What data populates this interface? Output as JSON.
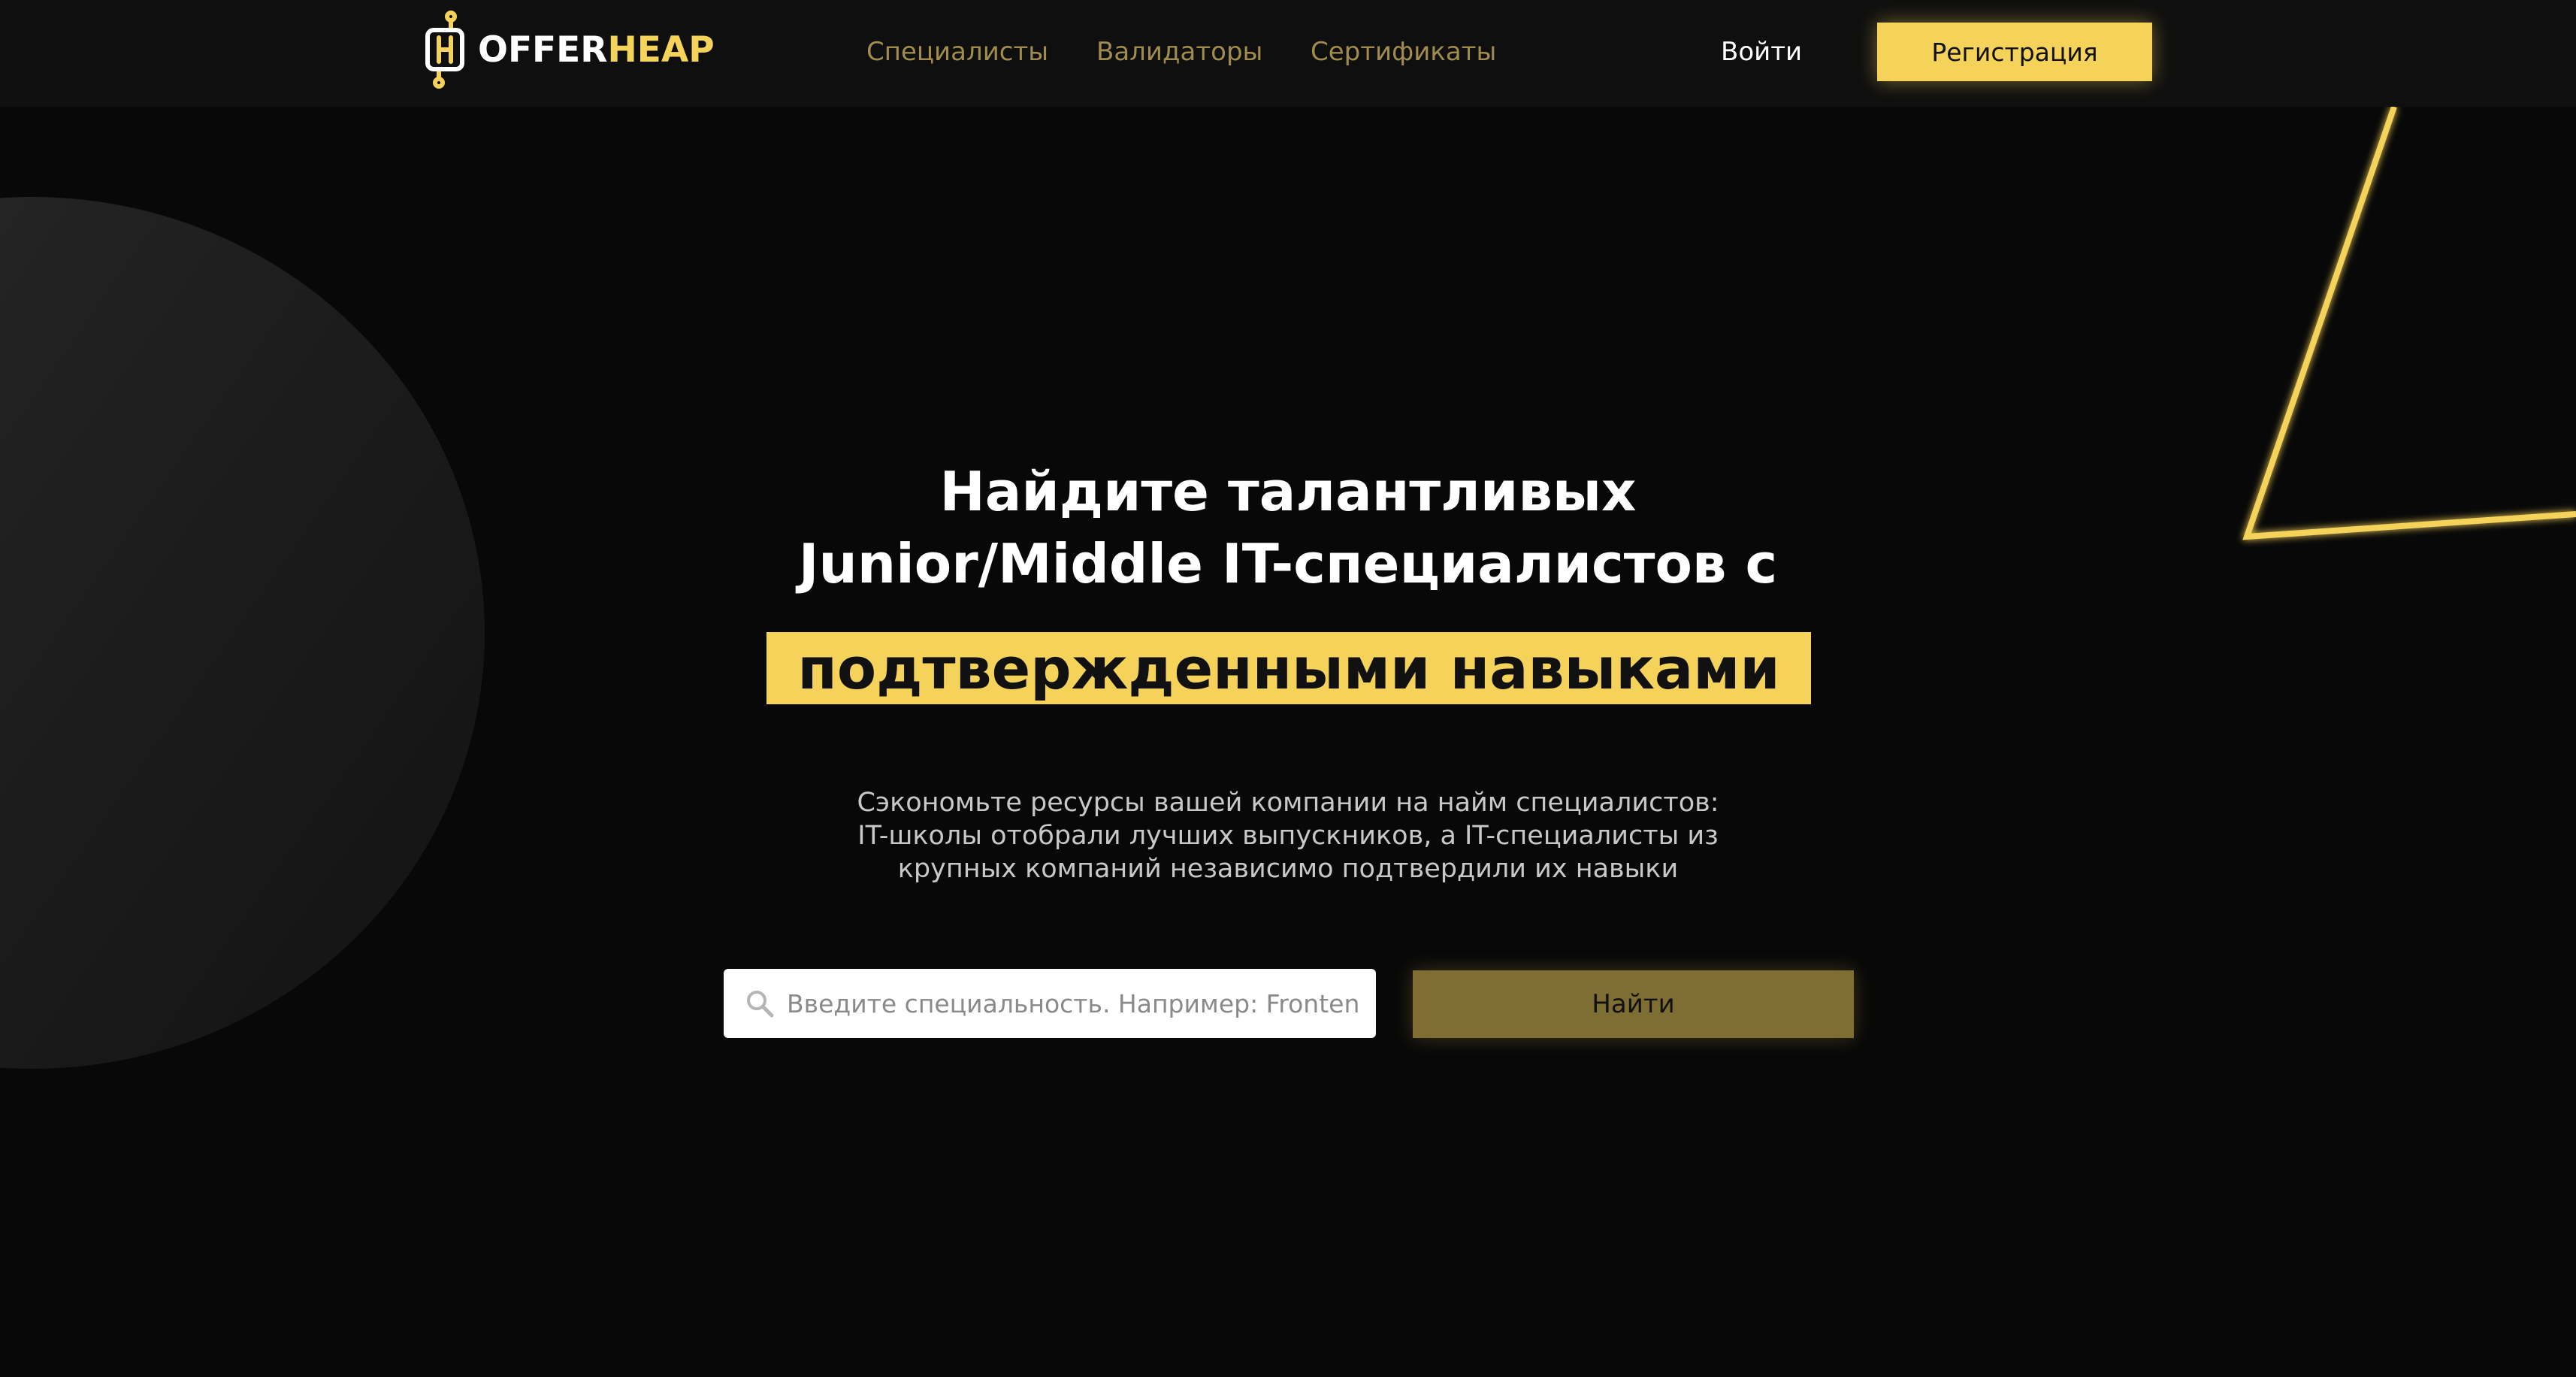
{
  "header": {
    "logo": {
      "text_white": "OFFER",
      "text_yellow": "HEAP",
      "icon": "offerheap-logo-icon"
    },
    "nav": [
      {
        "label": "Специалисты"
      },
      {
        "label": "Валидаторы"
      },
      {
        "label": "Сертификаты"
      }
    ],
    "login_label": "Войти",
    "register_label": "Регистрация"
  },
  "hero": {
    "title_line1": "Найдите талантливых",
    "title_line2": "Junior/Middle IT-специалистов с",
    "title_highlight": "подтвержденными навыками",
    "subtitle_line1": "Сэкономьте ресурсы вашей компании на найм специалистов:",
    "subtitle_line2": "IT-школы отобрали лучших выпускников, а IT-специалисты из",
    "subtitle_line3": "крупных компаний независимо подтвердили их навыки"
  },
  "search": {
    "placeholder": "Введите специальность. Например: Frontend",
    "value": "",
    "icon": "search-icon",
    "button_label": "Найти"
  },
  "colors": {
    "accent": "#f5d35a",
    "accent_muted": "#7f6e33",
    "nav_text": "#a08c4e",
    "background": "#080808",
    "header_background": "#0f0f0f"
  }
}
